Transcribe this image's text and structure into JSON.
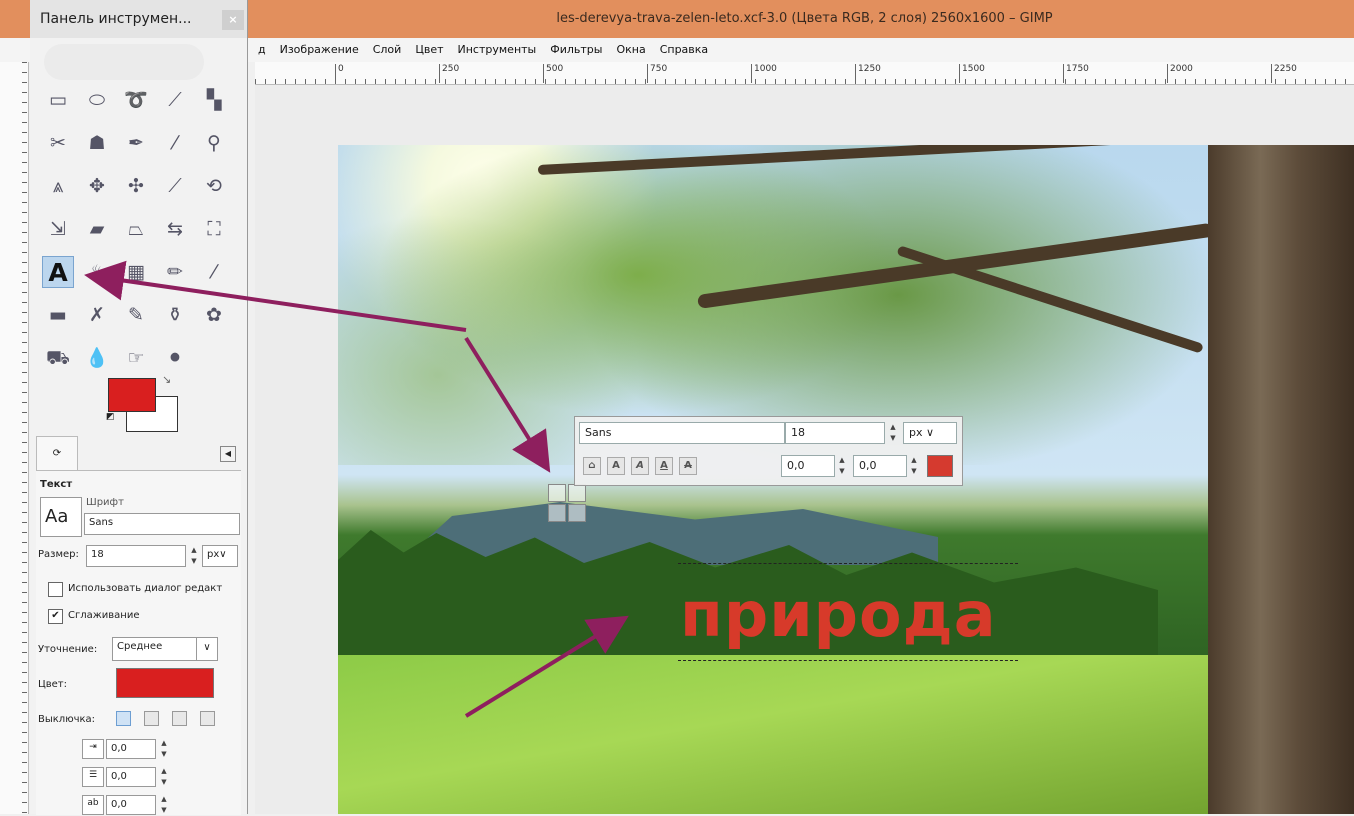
{
  "window": {
    "title": "les-derevya-trava-zelen-leto.xcf-3.0 (Цвета RGB, 2 слоя) 2560x1600 – GIMP",
    "menu": [
      "д",
      "Изображение",
      "Слой",
      "Цвет",
      "Инструменты",
      "Фильтры",
      "Окна",
      "Справка"
    ]
  },
  "ruler": {
    "top_ticks": [
      "0",
      "250",
      "500",
      "750",
      "1000",
      "1250",
      "1500",
      "1750",
      "2000",
      "2250"
    ]
  },
  "toolbox": {
    "title": "Панель инструмен...",
    "tools": [
      {
        "name": "rect-select-icon",
        "glyph": "▭"
      },
      {
        "name": "ellipse-select-icon",
        "glyph": "⬭"
      },
      {
        "name": "free-select-icon",
        "glyph": "➰"
      },
      {
        "name": "fuzzy-select-icon",
        "glyph": "⟋"
      },
      {
        "name": "select-by-color-icon",
        "glyph": "▚"
      },
      {
        "name": "scissors-icon",
        "glyph": "✂"
      },
      {
        "name": "foreground-select-icon",
        "glyph": "☗"
      },
      {
        "name": "paths-icon",
        "glyph": "✒"
      },
      {
        "name": "color-picker-icon",
        "glyph": "⁄"
      },
      {
        "name": "zoom-icon",
        "glyph": "⚲"
      },
      {
        "name": "measure-icon",
        "glyph": "⩓"
      },
      {
        "name": "move-icon",
        "glyph": "✥"
      },
      {
        "name": "align-icon",
        "glyph": "✣"
      },
      {
        "name": "crop-icon",
        "glyph": "⟋"
      },
      {
        "name": "rotate-icon",
        "glyph": "⟲"
      },
      {
        "name": "scale-icon",
        "glyph": "⇲"
      },
      {
        "name": "shear-icon",
        "glyph": "▰"
      },
      {
        "name": "perspective-icon",
        "glyph": "⏢"
      },
      {
        "name": "flip-icon",
        "glyph": "⇆"
      },
      {
        "name": "cage-icon",
        "glyph": "⛶"
      },
      {
        "name": "text-tool-icon",
        "glyph": "A"
      },
      {
        "name": "bucket-fill-icon",
        "glyph": "♨"
      },
      {
        "name": "blend-icon",
        "glyph": "▦"
      },
      {
        "name": "pencil-icon",
        "glyph": "✏"
      },
      {
        "name": "paintbrush-icon",
        "glyph": "⁄"
      },
      {
        "name": "eraser-icon",
        "glyph": "▬"
      },
      {
        "name": "airbrush-icon",
        "glyph": "✗"
      },
      {
        "name": "ink-icon",
        "glyph": "✎"
      },
      {
        "name": "clone-icon",
        "glyph": "⚱"
      },
      {
        "name": "heal-icon",
        "glyph": "✿"
      },
      {
        "name": "perspective-clone-icon",
        "glyph": "⛟"
      },
      {
        "name": "blur-icon",
        "glyph": "💧"
      },
      {
        "name": "smudge-icon",
        "glyph": "☞"
      },
      {
        "name": "dodge-burn-icon",
        "glyph": "⚫"
      }
    ],
    "fg_color": "#d91f1f",
    "bg_color": "#ffffff"
  },
  "tool_options": {
    "tab_label": "⟳",
    "section": "Текст",
    "font_label": "Шрифт",
    "font_preview": "Aa",
    "font_value": "Sans",
    "size_label": "Размер:",
    "size_value": "18",
    "size_unit": "px",
    "use_editor_label": "Использовать диалог редакт",
    "use_editor_checked": false,
    "antialias_label": "Сглаживание",
    "antialias_checked": true,
    "hinting_label": "Уточнение:",
    "hinting_value": "Среднее",
    "color_label": "Цвет:",
    "color_value": "#d91f1f",
    "justify_label": "Выключка:",
    "indent_value": "0,0",
    "line_spacing_value": "0,0",
    "letter_spacing_value": "0,0"
  },
  "text_toolbar": {
    "font": "Sans",
    "size": "18",
    "unit": "px",
    "baseline": "0,0",
    "kerning": "0,0",
    "color": "#d53a2f"
  },
  "canvas": {
    "text": "природа",
    "text_color": "#d73a2a"
  }
}
